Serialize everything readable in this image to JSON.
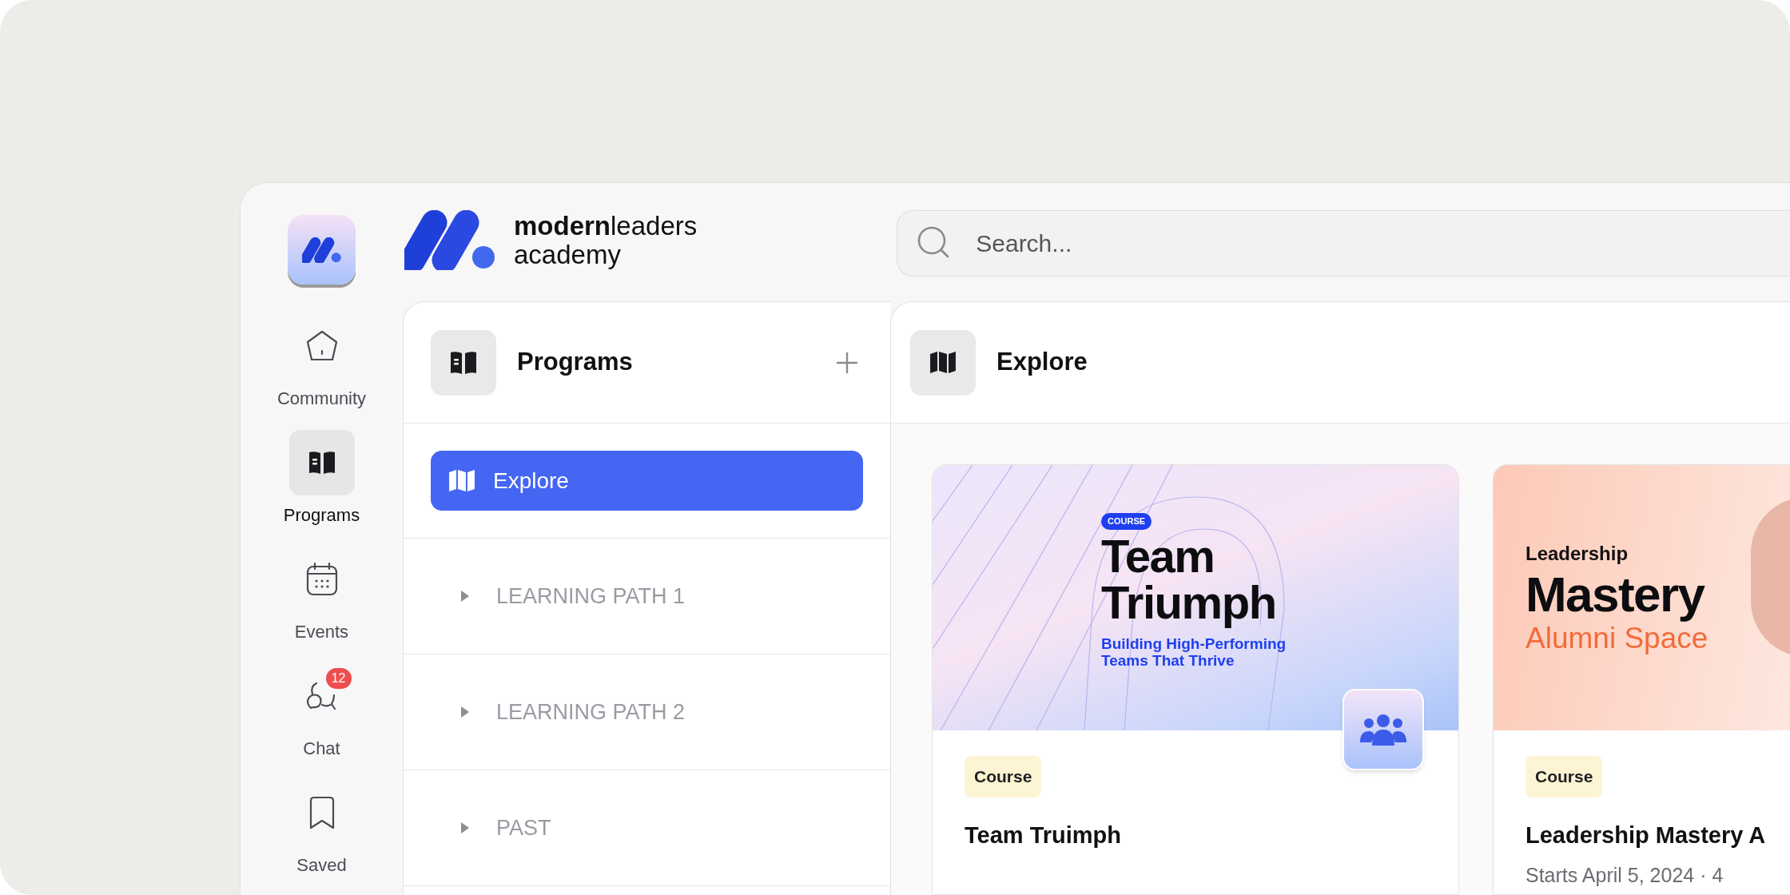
{
  "rail": {
    "items": [
      {
        "kind": "home",
        "label": "Community",
        "selected": false
      },
      {
        "kind": "book",
        "label": "Programs",
        "selected": true
      },
      {
        "kind": "calendar",
        "label": "Events",
        "selected": false
      },
      {
        "kind": "chat",
        "label": "Chat",
        "selected": false,
        "badge": "12"
      },
      {
        "kind": "bookmark",
        "label": "Saved",
        "selected": false
      }
    ]
  },
  "brand": {
    "line1": "**modern**leaders",
    "line2": "academy"
  },
  "search": {
    "placeholder": "Search..."
  },
  "programs_panel": {
    "title": "Programs",
    "nav": [
      {
        "label": "Explore",
        "selected": true
      }
    ],
    "sections": [
      {
        "label": "LEARNING PATH 1",
        "expanded": false
      },
      {
        "label": "LEARNING PATH 2",
        "expanded": false
      },
      {
        "label": "PAST",
        "expanded": false
      }
    ]
  },
  "explore_panel": {
    "title": "Explore",
    "cards": [
      {
        "banner": {
          "kind": "pattern",
          "tag": "COURSE",
          "title": "Team Triumph",
          "subtitle": "Building High-Performing Teams That Thrive"
        },
        "badge": "Course",
        "title": "Team Truimph"
      },
      {
        "banner": {
          "kind": "photo",
          "kicker": "Leadership",
          "title": "Mastery",
          "subtitle": "Alumni Space"
        },
        "badge": "Course",
        "title": "Leadership Mastery A",
        "meta": "Starts April 5, 2024 · 4"
      }
    ]
  }
}
